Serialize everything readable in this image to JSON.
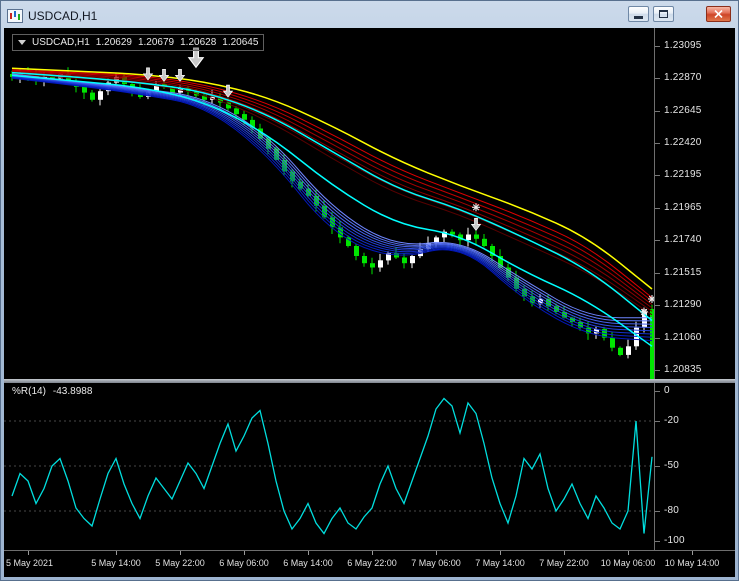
{
  "window": {
    "title": "USDCAD,H1"
  },
  "icons": {
    "window": "candlestick-chart-icon",
    "quote_dropdown": "chevron-down-icon",
    "minimize": "minimize-icon",
    "maximize": "maximize-icon",
    "close": "close-icon",
    "signal_arrow": "down-arrow-marker",
    "signal_star": "star-marker"
  },
  "quote": {
    "symbol": "USDCAD,H1",
    "open": "1.20629",
    "high": "1.20679",
    "low": "1.20628",
    "close": "1.20645"
  },
  "wpr": {
    "label": "%R(14)",
    "value": "-43.8988"
  },
  "colors": {
    "background": "#000000",
    "bull_candle": "#ffffff",
    "bear_candle": "#00e600",
    "wpr_line": "#00dede",
    "scale_text": "#e6e6e6",
    "slow_ma_yellow": "#ffff00",
    "mid_ma_cyan": "#00ffff"
  },
  "chart_data": {
    "type": "candlestick",
    "title": "USDCAD,H1",
    "symbol": "USDCAD",
    "timeframe": "H1",
    "x_axis": {
      "labels": [
        "5 May 2021",
        "5 May 14:00",
        "5 May 22:00",
        "6 May 06:00",
        "6 May 14:00",
        "6 May 22:00",
        "7 May 06:00",
        "7 May 14:00",
        "7 May 22:00",
        "10 May 06:00",
        "10 May 14:00"
      ],
      "tick_bars": [
        2,
        13,
        21,
        29,
        37,
        45,
        53,
        61,
        69,
        77,
        85
      ]
    },
    "price_axis": {
      "labels": [
        "1.23095",
        "1.22870",
        "1.22645",
        "1.22420",
        "1.22195",
        "1.21965",
        "1.21740",
        "1.21515",
        "1.21290",
        "1.21060",
        "1.20835"
      ],
      "ylim": [
        1.20772,
        1.23221
      ]
    },
    "closes": [
      1.2288,
      1.2291,
      1.2289,
      1.2286,
      1.2288,
      1.2287,
      1.229,
      1.2285,
      1.2281,
      1.2277,
      1.2272,
      1.2278,
      1.2284,
      1.2288,
      1.2283,
      1.2279,
      1.2274,
      1.2278,
      1.2283,
      1.2281,
      1.2277,
      1.228,
      1.2278,
      1.2275,
      1.2272,
      1.2274,
      1.227,
      1.2266,
      1.2262,
      1.2258,
      1.2252,
      1.2245,
      1.2238,
      1.223,
      1.2222,
      1.2215,
      1.221,
      1.2205,
      1.2198,
      1.219,
      1.2183,
      1.2176,
      1.217,
      1.2163,
      1.2158,
      1.2155,
      1.216,
      1.2165,
      1.2162,
      1.2158,
      1.2163,
      1.2168,
      1.2172,
      1.2176,
      1.218,
      1.2178,
      1.2174,
      1.2178,
      1.2175,
      1.217,
      1.2163,
      1.2155,
      1.2148,
      1.214,
      1.2135,
      1.213,
      1.2133,
      1.2128,
      1.2124,
      1.212,
      1.2117,
      1.2113,
      1.2109,
      1.2112,
      1.2106,
      1.2099,
      1.2094,
      1.21,
      1.2113,
      1.2126,
      1.20645
    ],
    "overlays": {
      "sample_bars": [
        0,
        8,
        16,
        24,
        32,
        40,
        48,
        56,
        64,
        72,
        80
      ],
      "lines": [
        {
          "name": "ema-slow-yellow-line",
          "color": "#ffff00",
          "width": 1.5,
          "values": [
            1.2294,
            1.2292,
            1.229,
            1.2285,
            1.2274,
            1.2254,
            1.223,
            1.2212,
            1.2196,
            1.2176,
            1.214
          ]
        },
        {
          "name": "ema-mid-cyan-line",
          "color": "#00ffff",
          "width": 1.5,
          "values": [
            1.2291,
            1.2288,
            1.2284,
            1.2278,
            1.2262,
            1.2236,
            1.221,
            1.2196,
            1.2176,
            1.2154,
            1.2118
          ]
        },
        {
          "name": "ema-fast-cyan-line",
          "color": "#00ffff",
          "width": 1.5,
          "values": [
            1.2289,
            1.2285,
            1.2281,
            1.2271,
            1.2248,
            1.2212,
            1.2185,
            1.2178,
            1.2152,
            1.2132,
            1.21
          ]
        }
      ],
      "bands": [
        {
          "name": "guppy-long-red-band",
          "colors": [
            "#e00000",
            "#c40000",
            "#a80000",
            "#8c0000",
            "#700000",
            "#580000"
          ],
          "top": [
            1.2293,
            1.2291,
            1.2289,
            1.2283,
            1.227,
            1.2248,
            1.2224,
            1.2207,
            1.219,
            1.217,
            1.2134
          ],
          "bottom": [
            1.229,
            1.2287,
            1.2284,
            1.2276,
            1.2258,
            1.2231,
            1.2206,
            1.2192,
            1.2172,
            1.2152,
            1.2122
          ]
        },
        {
          "name": "guppy-short-blue-band",
          "colors": [
            "#6f86ff",
            "#5a74f6",
            "#4662ec",
            "#3350e2",
            "#2340d8",
            "#1530ce",
            "#0a23c4",
            "#0318ba"
          ],
          "top": [
            1.229,
            1.2285,
            1.228,
            1.2274,
            1.2248,
            1.2196,
            1.2169,
            1.2175,
            1.2146,
            1.212,
            1.212
          ],
          "bottom": [
            1.2287,
            1.2282,
            1.2276,
            1.2268,
            1.2234,
            1.2178,
            1.216,
            1.2172,
            1.2132,
            1.2107,
            1.2104
          ]
        }
      ]
    },
    "markers": [
      {
        "bar": 17,
        "price": 1.2288,
        "type": "arrow"
      },
      {
        "bar": 19,
        "price": 1.2287,
        "type": "arrow"
      },
      {
        "bar": 21,
        "price": 1.2287,
        "type": "arrow"
      },
      {
        "bar": 23,
        "price": 1.2298,
        "type": "arrow",
        "size": "large"
      },
      {
        "bar": 27,
        "price": 1.2276,
        "type": "arrow"
      },
      {
        "bar": 58,
        "price": 1.2197,
        "type": "star"
      },
      {
        "bar": 58,
        "price": 1.2183,
        "type": "arrow"
      },
      {
        "bar": 79,
        "price": 1.2124,
        "type": "star"
      },
      {
        "bar": 80,
        "price": 1.2133,
        "type": "star"
      }
    ],
    "wpr_indicator": {
      "name": "%R(14)",
      "current_value": -43.8988,
      "ylim": [
        0,
        -100
      ],
      "levels": [
        -20,
        -50,
        -80
      ],
      "scale_labels": [
        "0",
        "-20",
        "-50",
        "-80",
        "-100"
      ],
      "values": [
        -70,
        -55,
        -60,
        -75,
        -65,
        -50,
        -45,
        -60,
        -78,
        -85,
        -90,
        -72,
        -55,
        -45,
        -62,
        -75,
        -85,
        -70,
        -58,
        -65,
        -72,
        -60,
        -48,
        -55,
        -65,
        -50,
        -35,
        -22,
        -40,
        -30,
        -18,
        -13,
        -35,
        -60,
        -80,
        -92,
        -85,
        -75,
        -88,
        -95,
        -85,
        -78,
        -88,
        -92,
        -84,
        -78,
        -62,
        -50,
        -65,
        -75,
        -60,
        -45,
        -30,
        -12,
        -5,
        -10,
        -28,
        -8,
        -15,
        -35,
        -58,
        -75,
        -88,
        -70,
        -45,
        -52,
        -42,
        -65,
        -80,
        -72,
        -62,
        -75,
        -85,
        -70,
        -78,
        -88,
        -92,
        -80,
        -20,
        -95,
        -43.8988
      ]
    }
  }
}
